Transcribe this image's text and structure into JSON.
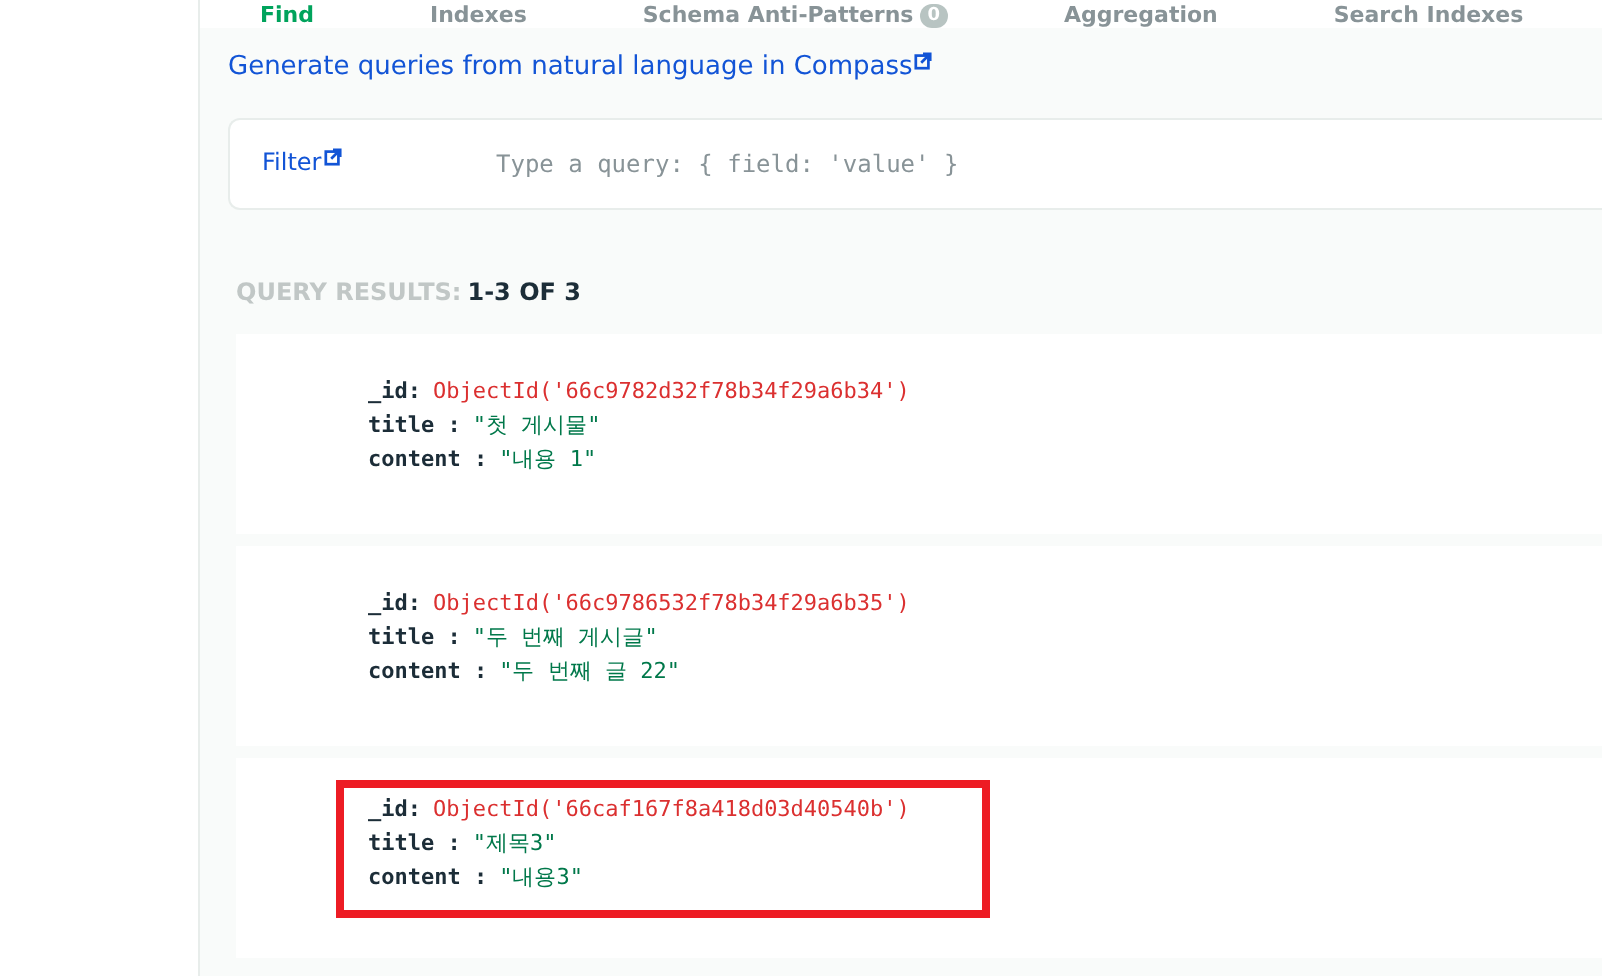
{
  "tabs": [
    {
      "label": "Find",
      "selected": true
    },
    {
      "label": "Indexes",
      "selected": false
    },
    {
      "label": "Schema Anti-Patterns",
      "badge": "0",
      "selected": false
    },
    {
      "label": "Aggregation",
      "selected": false
    },
    {
      "label": "Search Indexes",
      "selected": false
    }
  ],
  "nl_link": "Generate queries from natural language in Compass",
  "filter": {
    "label": "Filter",
    "placeholder": "Type a query: { field: 'value' }"
  },
  "results": {
    "label": "QUERY RESULTS:",
    "count": "1-3 OF 3"
  },
  "documents": [
    {
      "highlighted": false,
      "fields": [
        {
          "key": "_id:",
          "kind": "objectid",
          "value": "ObjectId('66c9782d32f78b34f29a6b34')"
        },
        {
          "key": "title :",
          "kind": "string",
          "value": "\"첫 게시물\""
        },
        {
          "key": "content :",
          "kind": "string",
          "value": "\"내용 1\""
        }
      ]
    },
    {
      "highlighted": false,
      "fields": [
        {
          "key": "_id:",
          "kind": "objectid",
          "value": "ObjectId('66c9786532f78b34f29a6b35')"
        },
        {
          "key": "title :",
          "kind": "string",
          "value": "\"두 번째 게시글\""
        },
        {
          "key": "content :",
          "kind": "string",
          "value": "\"두 번째 글 22\""
        }
      ]
    },
    {
      "highlighted": true,
      "fields": [
        {
          "key": "_id:",
          "kind": "objectid",
          "value": "ObjectId('66caf167f8a418d03d40540b')"
        },
        {
          "key": "title :",
          "kind": "string",
          "value": "\"제목3\""
        },
        {
          "key": "content :",
          "kind": "string",
          "value": "\"내용3\""
        }
      ]
    }
  ]
}
